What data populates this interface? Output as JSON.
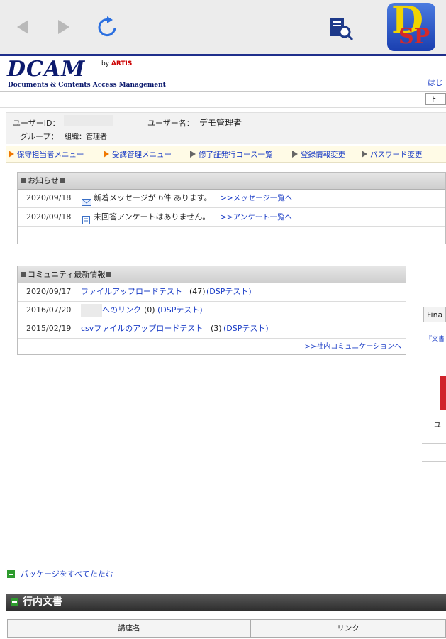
{
  "browser": {
    "back_icon": "back-arrow-icon",
    "forward_icon": "forward-arrow-icon",
    "reload_icon": "reload-icon",
    "doc_search_icon": "document-search-icon",
    "app_logo_text_top": "D",
    "app_logo_text_bottom": "SP"
  },
  "header": {
    "logo": "DCAM",
    "logo_by": "by",
    "logo_brand": "ARTIS",
    "subtitle": "Documents & Contents Access Management",
    "help_link": "はじ",
    "top_box": "ト"
  },
  "user": {
    "id_label": "ユーザーID：",
    "name_label": "ユーザー名：",
    "name_value": "デモ管理者",
    "group_label": "グループ：",
    "group_value": "組織：管理者"
  },
  "menu": [
    {
      "label": "保守担当者メニュー",
      "marker": "orange"
    },
    {
      "label": "受講管理メニュー",
      "marker": "orange"
    },
    {
      "label": "修了証発行コース一覧",
      "marker": "gray"
    },
    {
      "label": "登録情報変更",
      "marker": "gray"
    },
    {
      "label": "パスワード変更",
      "marker": "gray"
    }
  ],
  "notices": {
    "title": "お知らせ",
    "rows": [
      {
        "date": "2020/09/18",
        "icon": "mail-icon",
        "pre": "新着メッセージが",
        "count": "6件",
        "post": "あります。",
        "link": ">>メッセージ一覧へ"
      },
      {
        "date": "2020/09/18",
        "icon": "survey-icon",
        "pre": "未回答アンケートはありません。",
        "count": "",
        "post": "",
        "link": ">>アンケート一覧へ"
      }
    ]
  },
  "community": {
    "title": "コミュニティ最新情報",
    "rows": [
      {
        "date": "2020/09/17",
        "title": "ファイルアップロードテスト",
        "count": "(47)",
        "group": "(DSPテスト)"
      },
      {
        "date": "2016/07/20",
        "title": "へのリンク",
        "count": "(0)",
        "group": "(DSPテスト)"
      },
      {
        "date": "2015/02/19",
        "title": "csvファイルのアップロードテスト",
        "count": "(3)",
        "group": "(DSPテスト)"
      }
    ],
    "footer_link": ">>社内コミュニケーションへ"
  },
  "right": {
    "fina_button": "Fina",
    "doc_link": "『文書",
    "user_frag": "ユ"
  },
  "package": {
    "collapse_label": "パッケージをすべてたたむ"
  },
  "section": {
    "title": "行内文書"
  },
  "table": {
    "headers": [
      "講座名",
      "リンク"
    ]
  },
  "colors": {
    "accent_blue": "#1a3cc6",
    "navy": "#0c1a6e",
    "orange_marker": "#f07800",
    "green": "#2e9b2e"
  }
}
